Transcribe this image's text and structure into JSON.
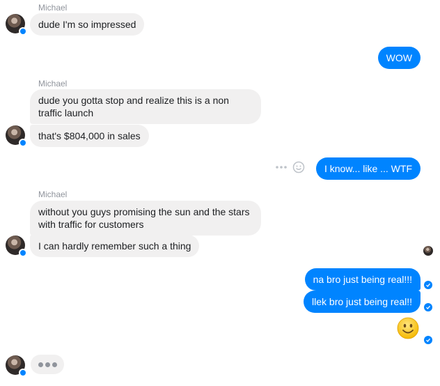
{
  "conversation": {
    "sender_name": "Michael",
    "messages": {
      "m1": "dude I'm so impressed",
      "m2": "WOW",
      "m3": "dude you gotta stop and realize this is a non traffic launch",
      "m4": "that's $804,000 in sales",
      "m5": "I know... like ... WTF",
      "m6": "without you guys promising the sun and the stars with traffic for customers",
      "m7": "I can hardly remember such a thing",
      "m8": "na bro just being real!!!",
      "m9": "llek bro just being real!!",
      "m10_emoji": "🙂"
    }
  },
  "icons": {
    "more": "more-dots-icon",
    "react": "smiley-react-icon",
    "sent": "check-circle-icon",
    "messenger_badge": "messenger-badge-icon"
  },
  "colors": {
    "outgoing": "#0084ff",
    "incoming": "#f1f0f0",
    "meta": "#90949c"
  }
}
